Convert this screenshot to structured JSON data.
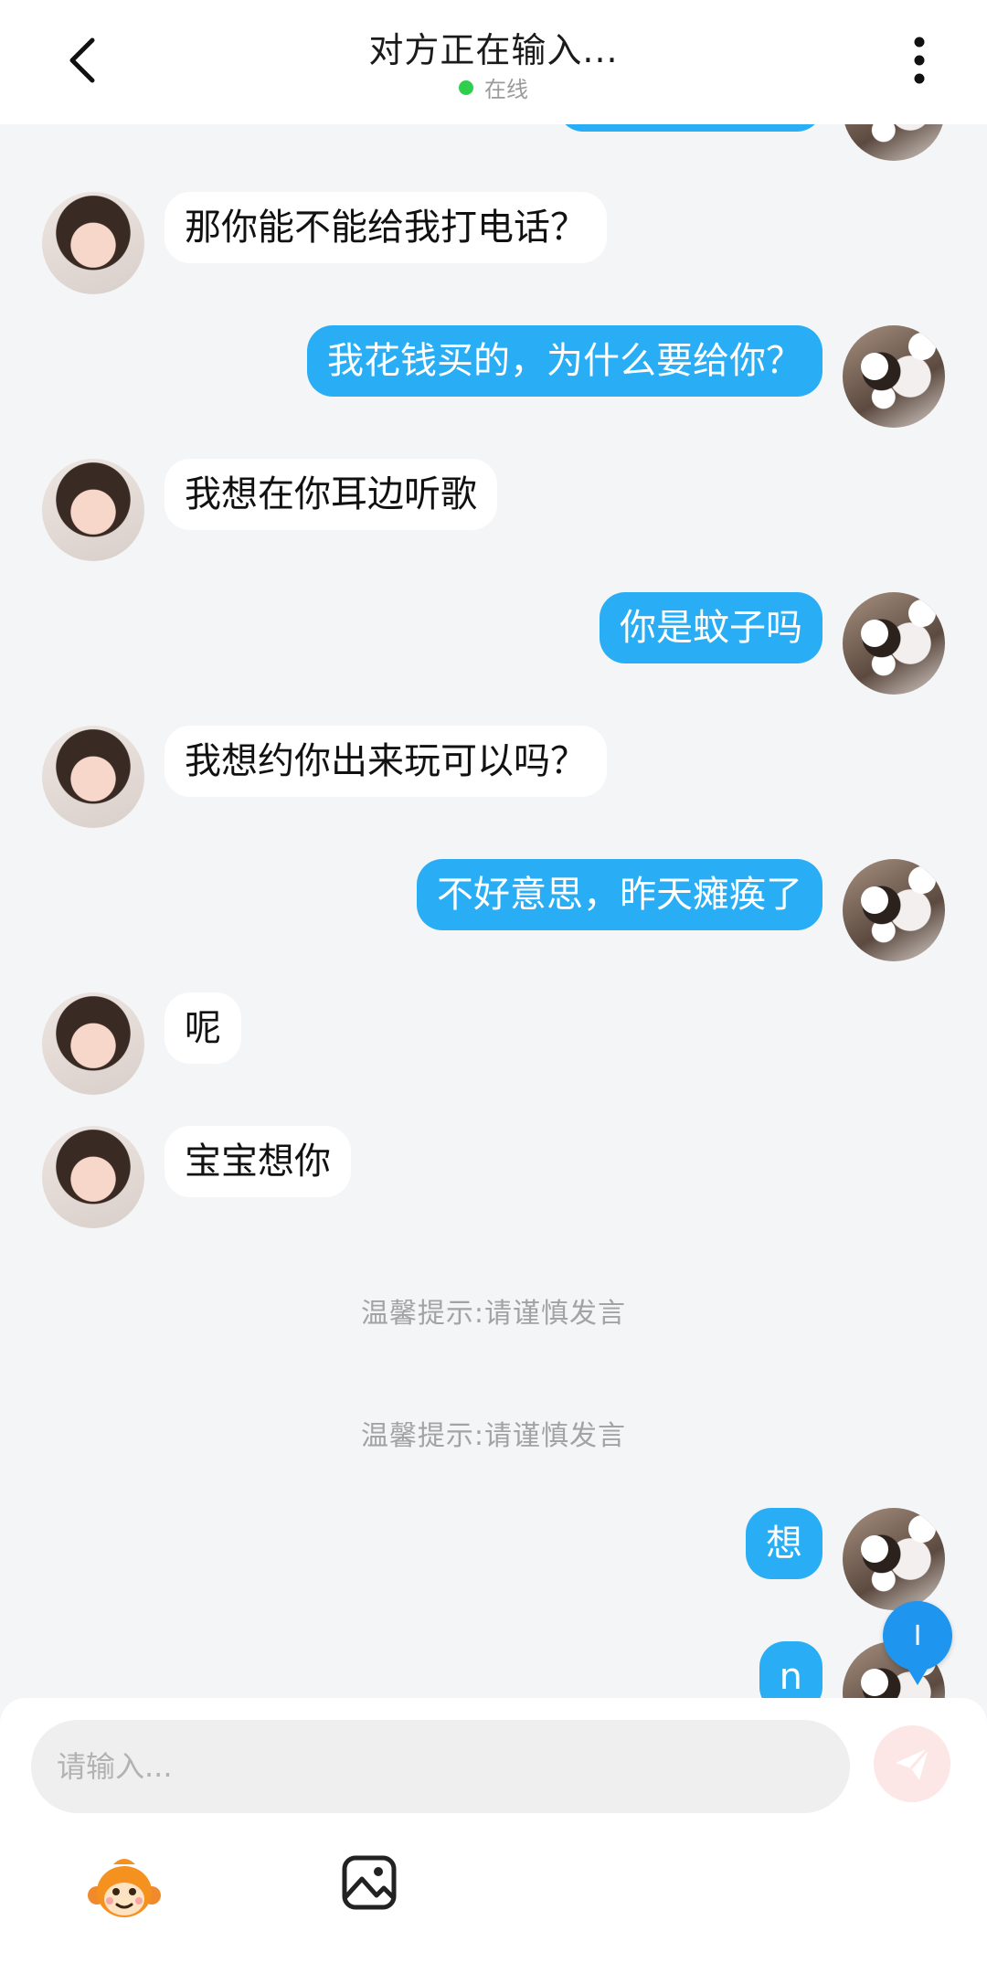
{
  "header": {
    "title": "对方正在输入...",
    "status": "在线",
    "status_color": "#2fcf4d",
    "back_icon": "chevron-left-icon",
    "more_icon": "more-vertical-icon"
  },
  "messages": [
    {
      "side": "right",
      "text": ""
    },
    {
      "side": "left",
      "text": "那你能不能给我打电话？"
    },
    {
      "side": "right",
      "text": "我花钱买的，为什么要给你？"
    },
    {
      "side": "left",
      "text": "我想在你耳边听歌"
    },
    {
      "side": "right",
      "text": "你是蚊子吗"
    },
    {
      "side": "left",
      "text": "我想约你出来玩可以吗？"
    },
    {
      "side": "right",
      "text": "不好意思，昨天瘫痪了"
    },
    {
      "side": "left",
      "text": "呢"
    },
    {
      "side": "left",
      "text": "宝宝想你"
    },
    {
      "side": "system",
      "text": "温馨提示:请谨慎发言"
    },
    {
      "side": "system",
      "text": "温馨提示:请谨慎发言"
    },
    {
      "side": "right",
      "text": "想"
    },
    {
      "side": "right",
      "text": "n"
    }
  ],
  "badge": {
    "text": "I"
  },
  "composer": {
    "placeholder": "请输入...",
    "value": "",
    "send_icon": "paper-plane-icon",
    "tools": [
      "monkey-emoji-icon",
      "image-icon"
    ]
  },
  "colors": {
    "outgoing_bubble": "#29aef5",
    "incoming_bubble": "#ffffff",
    "background": "#f4f5f7",
    "send_button": "#fde6e6"
  }
}
